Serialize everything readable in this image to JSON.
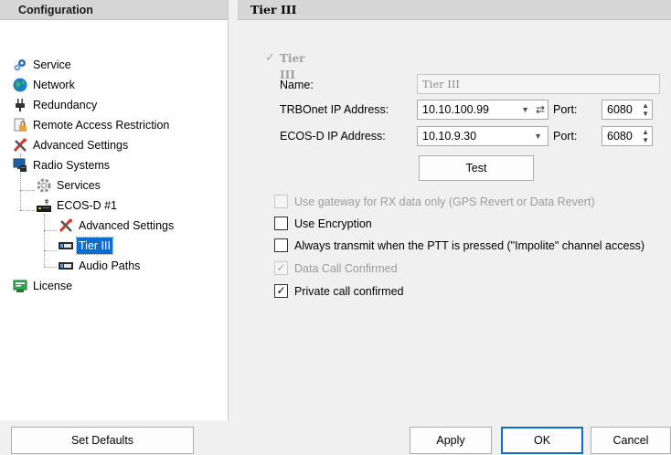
{
  "left_panel": {
    "header": "Configuration",
    "items": [
      {
        "label": "Service",
        "icon": "gears-icon"
      },
      {
        "label": "Network",
        "icon": "globe-icon"
      },
      {
        "label": "Redundancy",
        "icon": "plug-icon"
      },
      {
        "label": "Remote Access Restriction",
        "icon": "document-lock-icon"
      },
      {
        "label": "Advanced Settings",
        "icon": "tools-icon"
      },
      {
        "label": "Radio Systems",
        "icon": "monitor-icon"
      },
      {
        "label": "Services",
        "icon": "gear-icon"
      },
      {
        "label": "ECOS-D #1",
        "icon": "radio-device-icon"
      },
      {
        "label": "Advanced Settings",
        "icon": "tools-icon"
      },
      {
        "label": "Tier III",
        "icon": "slot-icon"
      },
      {
        "label": "Audio Paths",
        "icon": "slot-icon"
      },
      {
        "label": "License",
        "icon": "license-icon"
      }
    ],
    "selected": "Tier III"
  },
  "right_panel": {
    "header": "Tier III",
    "section_checkbox": {
      "label": "Tier III",
      "checked": true,
      "disabled": true
    },
    "name": {
      "label": "Name:",
      "value": "Tier III"
    },
    "trbonet_ip": {
      "label": "TRBOnet IP Address:",
      "value": "10.10.100.99",
      "port_label": "Port:",
      "port": "6080"
    },
    "ecos_ip": {
      "label": "ECOS-D IP Address:",
      "value": "10.10.9.30",
      "port_label": "Port:",
      "port": "6080"
    },
    "test_button": "Test",
    "options": [
      {
        "label": "Use gateway for RX data only (GPS Revert or Data Revert)",
        "checked": false,
        "disabled": true
      },
      {
        "label": "Use Encryption",
        "checked": false,
        "disabled": false
      },
      {
        "label": "Always transmit when the PTT is pressed (\"Impolite\" channel access)",
        "checked": false,
        "disabled": false
      },
      {
        "label": "Data Call Confirmed",
        "checked": true,
        "disabled": true
      },
      {
        "label": "Private call confirmed",
        "checked": true,
        "disabled": false
      }
    ]
  },
  "buttons": {
    "set_defaults": "Set Defaults",
    "apply": "Apply",
    "ok": "OK",
    "cancel": "Cancel"
  },
  "colors": {
    "selection": "#0a6ed1",
    "header_bg": "#d6d6d6"
  }
}
